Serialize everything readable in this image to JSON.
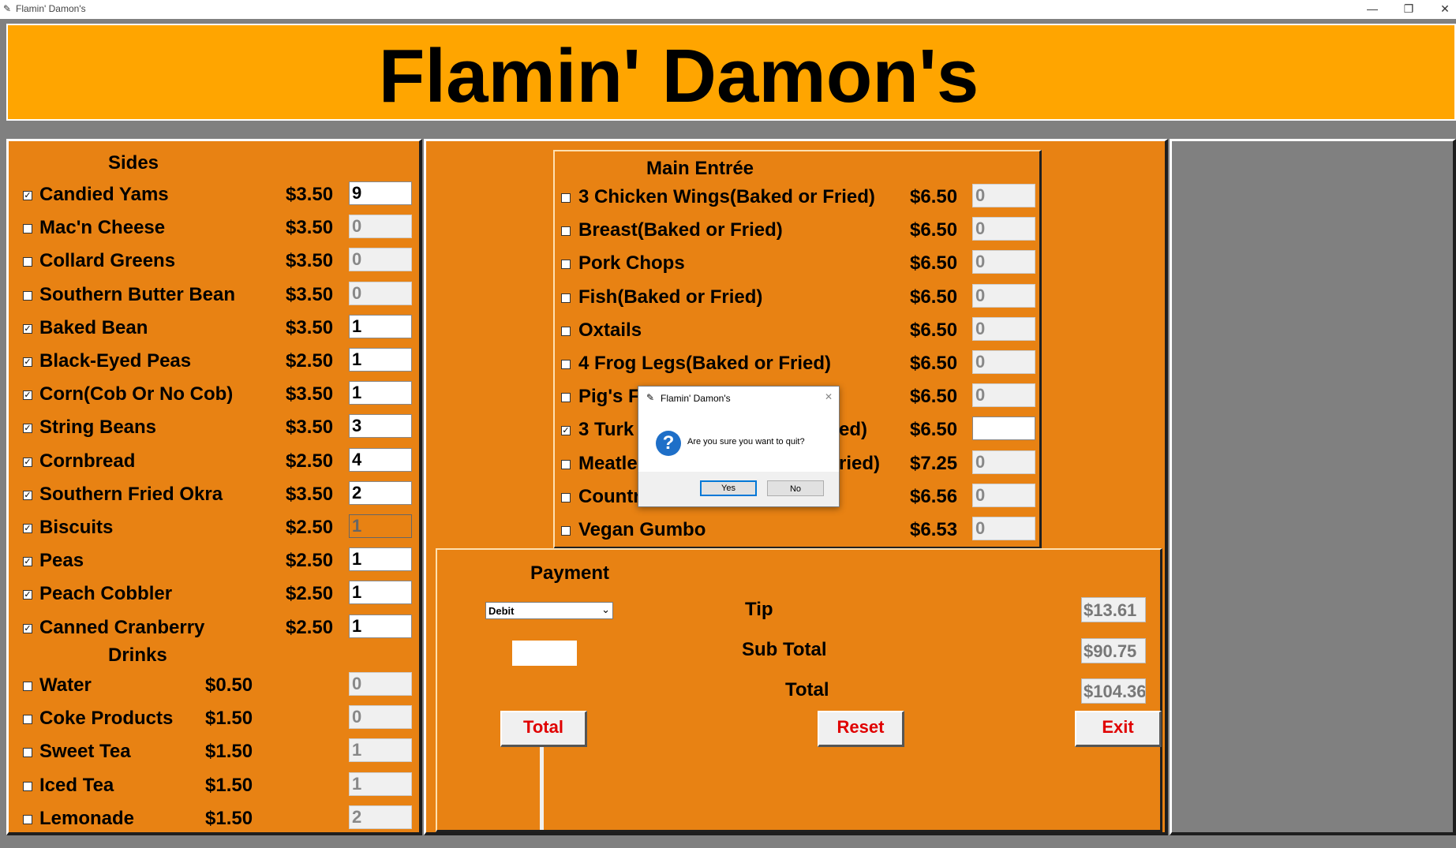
{
  "window": {
    "title": "Flamin' Damon's",
    "minimize": "—",
    "restore": "❐",
    "close": "✕"
  },
  "banner": {
    "title": "Flamin' Damon's"
  },
  "sides": {
    "heading": "Sides",
    "items": [
      {
        "label": "Candied Yams",
        "price": "$3.50",
        "qty": "9",
        "checked": true,
        "state": "active"
      },
      {
        "label": "Mac'n Cheese",
        "price": "$3.50",
        "qty": "0",
        "checked": false,
        "state": "disabled"
      },
      {
        "label": "Collard Greens",
        "price": "$3.50",
        "qty": "0",
        "checked": false,
        "state": "disabled"
      },
      {
        "label": "Southern Butter Bean",
        "price": "$3.50",
        "qty": "0",
        "checked": false,
        "state": "disabled"
      },
      {
        "label": "Baked Bean",
        "price": "$3.50",
        "qty": "1",
        "checked": true,
        "state": "active"
      },
      {
        "label": "Black-Eyed Peas",
        "price": "$2.50",
        "qty": "1",
        "checked": true,
        "state": "active"
      },
      {
        "label": "Corn(Cob Or No Cob)",
        "price": "$3.50",
        "qty": "1",
        "checked": true,
        "state": "active"
      },
      {
        "label": "String Beans",
        "price": "$3.50",
        "qty": "3",
        "checked": true,
        "state": "active"
      },
      {
        "label": "Cornbread",
        "price": "$2.50",
        "qty": "4",
        "checked": true,
        "state": "active"
      },
      {
        "label": "Southern Fried Okra",
        "price": "$3.50",
        "qty": "2",
        "checked": true,
        "state": "active"
      },
      {
        "label": "Biscuits",
        "price": "$2.50",
        "qty": "1",
        "checked": true,
        "state": "readonly"
      },
      {
        "label": "Peas",
        "price": "$2.50",
        "qty": "1",
        "checked": true,
        "state": "active"
      },
      {
        "label": "Peach Cobbler",
        "price": "$2.50",
        "qty": "1",
        "checked": true,
        "state": "active"
      },
      {
        "label": "Canned Cranberry",
        "price": "$2.50",
        "qty": "1",
        "checked": true,
        "state": "active"
      }
    ]
  },
  "drinks": {
    "heading": "Drinks",
    "items": [
      {
        "label": "Water",
        "price": "$0.50",
        "qty": "0",
        "checked": false,
        "state": "disabled"
      },
      {
        "label": "Coke Products",
        "price": "$1.50",
        "qty": "0",
        "checked": false,
        "state": "disabled"
      },
      {
        "label": "Sweet Tea",
        "price": "$1.50",
        "qty": "1",
        "checked": false,
        "state": "disabled"
      },
      {
        "label": "Iced Tea",
        "price": "$1.50",
        "qty": "1",
        "checked": false,
        "state": "disabled"
      },
      {
        "label": "Lemonade",
        "price": "$1.50",
        "qty": "2",
        "checked": false,
        "state": "disabled"
      }
    ]
  },
  "entree": {
    "heading": "Main Entrée",
    "items": [
      {
        "label": " 3 Chicken Wings(Baked or Fried)",
        "price": "$6.50",
        "qty": "0",
        "checked": false,
        "state": "disabled"
      },
      {
        "label": "Breast(Baked or Fried)",
        "price": "$6.50",
        "qty": "0",
        "checked": false,
        "state": "disabled"
      },
      {
        "label": "Pork Chops",
        "price": "$6.50",
        "qty": "0",
        "checked": false,
        "state": "disabled"
      },
      {
        "label": "Fish(Baked or Fried)",
        "price": "$6.50",
        "qty": "0",
        "checked": false,
        "state": "disabled"
      },
      {
        "label": "Oxtails",
        "price": "$6.50",
        "qty": "0",
        "checked": false,
        "state": "disabled"
      },
      {
        "label": "4 Frog Legs(Baked or Fried)",
        "price": "$6.50",
        "qty": "0",
        "checked": false,
        "state": "disabled"
      },
      {
        "label": "Pig's F",
        "price": "$6.50",
        "qty": "0",
        "checked": false,
        "state": "disabled"
      },
      {
        "label": "3 Turk",
        "suffix": "ed)",
        "price": "$6.50",
        "qty": "",
        "checked": true,
        "state": "active"
      },
      {
        "label": "Meatle",
        "suffix": "ried)",
        "price": "$7.25",
        "qty": "0",
        "checked": false,
        "state": "disabled"
      },
      {
        "label": "Countr",
        "price": "$6.56",
        "qty": "0",
        "checked": false,
        "state": "disabled"
      },
      {
        "label": "Vegan Gumbo",
        "price": "$6.53",
        "qty": "0",
        "checked": false,
        "state": "disabled"
      }
    ]
  },
  "payment": {
    "heading": "Payment",
    "method": "Debit",
    "cash_value": "",
    "tip_label": "Tip",
    "tip_value": "$13.61",
    "subtotal_label": "Sub Total",
    "subtotal_value": "$90.75",
    "total_label": "Total",
    "total_value": "$104.36",
    "btn_total": "Total",
    "btn_reset": "Reset",
    "btn_exit": "Exit"
  },
  "dialog": {
    "title": "Flamin' Damon's",
    "message": "Are you sure you want to quit?",
    "icon": "?",
    "yes": "Yes",
    "no": "No",
    "close": "✕"
  },
  "colors": {
    "banner": "#ffa500",
    "panel": "#e88213",
    "frame": "#808080",
    "button_text": "#e00000"
  }
}
